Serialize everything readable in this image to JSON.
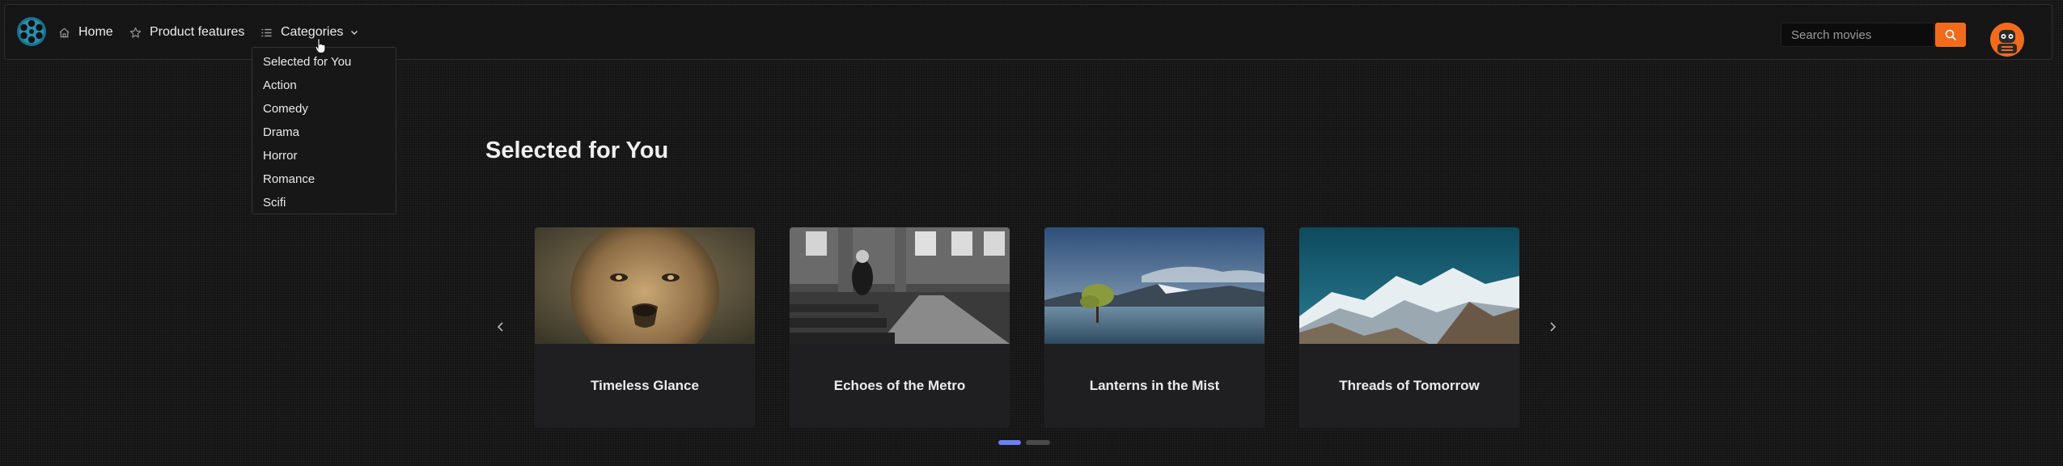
{
  "nav": {
    "home_label": "Home",
    "product_features_label": "Product features",
    "categories_label": "Categories",
    "search_placeholder": "Search movies"
  },
  "dropdown": {
    "items": [
      "Selected for You",
      "Action",
      "Comedy",
      "Drama",
      "Horror",
      "Romance",
      "Scifi"
    ]
  },
  "section": {
    "title": "Selected for You"
  },
  "movies": [
    {
      "title": "Timeless Glance",
      "image": "lion-face"
    },
    {
      "title": "Echoes of the Metro",
      "image": "man-in-church"
    },
    {
      "title": "Lanterns in the Mist",
      "image": "tree-in-lake"
    },
    {
      "title": "Threads of Tomorrow",
      "image": "snowy-mountains"
    }
  ],
  "carousel": {
    "active_page": 1,
    "page_count": 2
  },
  "colors": {
    "accent": "#f26b1d",
    "dot_active": "#6f7ff0",
    "dot_inactive": "#4a4a4a",
    "logo": "#2a8fb0"
  }
}
